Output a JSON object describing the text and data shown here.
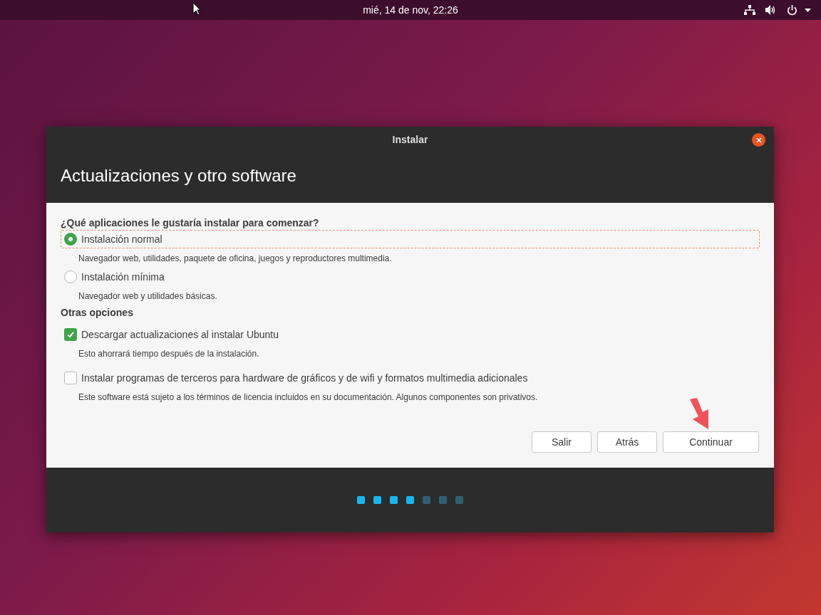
{
  "top_bar": {
    "clock": "mié, 14 de nov, 22:26"
  },
  "window": {
    "title": "Instalar",
    "heading": "Actualizaciones y otro software"
  },
  "sections": [
    {
      "title": "¿Qué aplicaciones le gustaría instalar para comenzar?",
      "options": [
        {
          "kind": "radio",
          "label": "Instalación normal",
          "description": "Navegador web, utilidades, paquete de oficina, juegos y reproductores multimedia.",
          "selected": true
        },
        {
          "kind": "radio",
          "label": "Instalación mínima",
          "description": "Navegador web y utilidades básicas.",
          "selected": false
        }
      ]
    },
    {
      "title": "Otras opciones",
      "options": [
        {
          "kind": "checkbox",
          "label": "Descargar actualizaciones al instalar Ubuntu",
          "description": "Esto ahorrará tiempo después de la instalación.",
          "checked": true
        },
        {
          "kind": "checkbox",
          "label": "Instalar programas de terceros para hardware de gráficos y de wifi y formatos multimedia adicionales",
          "description": "Este software está sujeto a los términos de licencia incluidos en su documentación. Algunos componentes son privativos.",
          "checked": false
        }
      ]
    }
  ],
  "buttons": [
    "Salir",
    "Atrás",
    "Continuar"
  ],
  "progress": [
    {
      "done": true
    },
    {
      "done": true
    },
    {
      "done": true
    },
    {
      "done": true
    },
    {
      "done": false
    },
    {
      "done": false
    },
    {
      "done": false
    }
  ]
}
